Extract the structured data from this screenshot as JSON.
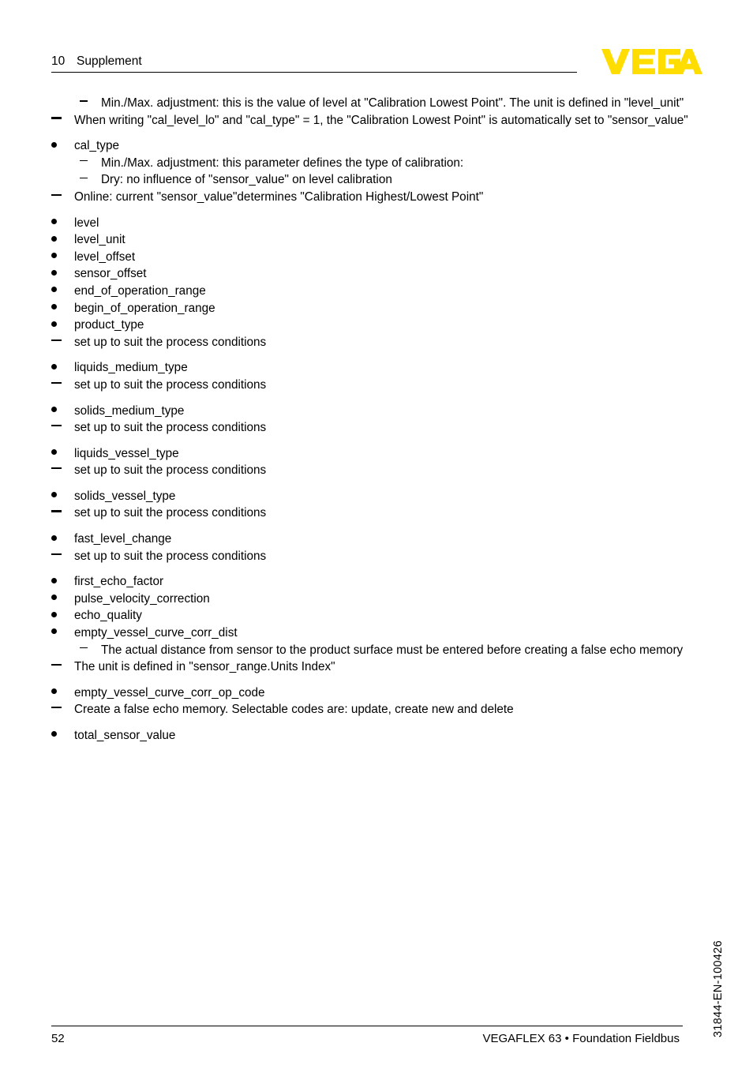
{
  "header": {
    "chapter_number": "10",
    "chapter_title": "Supplement",
    "logo_text": "VEGA",
    "logo_color": "#FFDD00"
  },
  "footer": {
    "page_number": "52",
    "product_line": "VEGAFLEX 63 • Foundation Fieldbus",
    "document_code": "31844-EN-100426"
  },
  "content": {
    "blocks": [
      {
        "id": "cal_level_lo_notes",
        "items": [
          {
            "level": 2,
            "marker": "dash-short",
            "text": "Min./Max. adjustment: this is the value of level at \"Calibration Lowest Point\". The unit is defined in \"level_unit\""
          },
          {
            "level": 1,
            "marker": "dash-long",
            "text": "When writing \"cal_level_lo\" and \"cal_type\" = 1, the \"Calibration Lowest Point\" is automatically set to \"sensor_value\""
          }
        ]
      },
      {
        "id": "cal_type",
        "items": [
          {
            "level": 1,
            "marker": "bullet",
            "text": "cal_type"
          },
          {
            "level": 2,
            "marker": "dash-short",
            "text": "Min./Max. adjustment: this parameter defines the type of calibration:"
          },
          {
            "level": 2,
            "marker": "dash-short",
            "text": "Dry: no influence of \"sensor_value\" on level calibration"
          },
          {
            "level": 1,
            "marker": "dash-long",
            "text": "Online: current \"sensor_value\"determines \"Calibration Highest/Lowest Point\""
          }
        ]
      },
      {
        "id": "parameter_list",
        "items": [
          {
            "level": 1,
            "marker": "bullet",
            "text": "level"
          },
          {
            "level": 1,
            "marker": "bullet",
            "text": "level_unit"
          },
          {
            "level": 1,
            "marker": "bullet",
            "text": "level_offset"
          },
          {
            "level": 1,
            "marker": "bullet",
            "text": "sensor_offset"
          },
          {
            "level": 1,
            "marker": "bullet",
            "text": "end_of_operation_range"
          },
          {
            "level": 1,
            "marker": "bullet",
            "text": "begin_of_operation_range"
          },
          {
            "level": 1,
            "marker": "bullet",
            "text": "product_type"
          },
          {
            "level": 1,
            "marker": "dash-long",
            "text": "set up to suit the process conditions"
          }
        ]
      },
      {
        "id": "liquids_medium_type",
        "items": [
          {
            "level": 1,
            "marker": "bullet",
            "text": "liquids_medium_type"
          },
          {
            "level": 1,
            "marker": "dash-long",
            "text": "set up to suit the process conditions"
          }
        ]
      },
      {
        "id": "solids_medium_type",
        "items": [
          {
            "level": 1,
            "marker": "bullet",
            "text": "solids_medium_type"
          },
          {
            "level": 1,
            "marker": "dash-long",
            "text": "set up to suit the process conditions"
          }
        ]
      },
      {
        "id": "liquids_vessel_type",
        "items": [
          {
            "level": 1,
            "marker": "bullet",
            "text": "liquids_vessel_type"
          },
          {
            "level": 1,
            "marker": "dash-long",
            "text": "set up to suit the process conditions"
          }
        ]
      },
      {
        "id": "solids_vessel_type",
        "items": [
          {
            "level": 1,
            "marker": "bullet",
            "text": "solids_vessel_type"
          },
          {
            "level": 1,
            "marker": "dash-long",
            "text": "set up to suit the process conditions"
          }
        ]
      },
      {
        "id": "fast_level_change",
        "items": [
          {
            "level": 1,
            "marker": "bullet",
            "text": "fast_level_change"
          },
          {
            "level": 1,
            "marker": "dash-long",
            "text": "set up to suit the process conditions"
          }
        ]
      },
      {
        "id": "echo_parameters",
        "items": [
          {
            "level": 1,
            "marker": "bullet",
            "text": "first_echo_factor"
          },
          {
            "level": 1,
            "marker": "bullet",
            "text": "pulse_velocity_correction"
          },
          {
            "level": 1,
            "marker": "bullet",
            "text": "echo_quality"
          },
          {
            "level": 1,
            "marker": "bullet",
            "text": "empty_vessel_curve_corr_dist"
          },
          {
            "level": 2,
            "marker": "dash-short",
            "text": "The actual distance from sensor to the product surface must be entered before creating a false echo memory"
          },
          {
            "level": 1,
            "marker": "dash-long",
            "text": "The unit is defined in \"sensor_range.Units Index\""
          }
        ]
      },
      {
        "id": "empty_vessel_curve_corr_op_code",
        "items": [
          {
            "level": 1,
            "marker": "bullet",
            "text": "empty_vessel_curve_corr_op_code"
          },
          {
            "level": 1,
            "marker": "dash-long",
            "text": "Create a false echo memory. Selectable codes are: update, create new and delete"
          }
        ]
      },
      {
        "id": "total_sensor_value",
        "items": [
          {
            "level": 1,
            "marker": "bullet",
            "text": "total_sensor_value"
          }
        ]
      }
    ]
  }
}
